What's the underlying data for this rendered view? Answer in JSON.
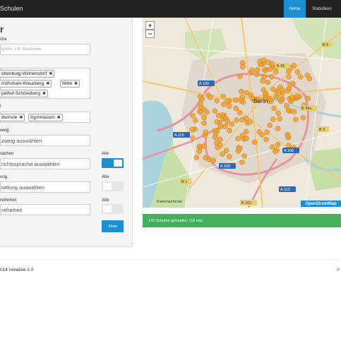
{
  "navbar": {
    "brand": "Schulen",
    "home_label": "Home",
    "stats_label": "Statistiken"
  },
  "filter": {
    "title": "r",
    "search": {
      "label": "che",
      "placeholder": "Suche, z.B. Schulname"
    },
    "districts": {
      "tags": [
        "ottenburg-Wilmersdorf",
        "rrichshain-Kreuzberg",
        "Mitte",
        "pelhof-Schöneberg"
      ]
    },
    "type": {
      "label": "l",
      "tags": [
        "dschule",
        "Gymnasium"
      ]
    },
    "branch": {
      "label": "weig",
      "placeholder": "zweig auswählen"
    },
    "language": {
      "label": "sachen",
      "placeholder": "richtssprache auswählen",
      "toggle_label": "Alle",
      "toggle_on": true
    },
    "equipment": {
      "label": "ung",
      "placeholder": "tattung auswählen",
      "toggle_label": "Alle",
      "toggle_on": false
    },
    "barrier": {
      "label": "refreiheit",
      "placeholder": "refreiheit",
      "toggle_label": "Alle",
      "toggle_on": false
    },
    "show_button": "Show"
  },
  "map": {
    "zoom_in": "+",
    "zoom_out": "−",
    "attribution": "OpenStreetMap",
    "city_label": "Berlin",
    "place_label": "Kleinmachnow",
    "road_labels": [
      "A 100",
      "A 100",
      "A 115",
      "A 100",
      "A 113",
      "B 96",
      "B 96a",
      "B 101",
      "B 1",
      "B 2",
      "B 5"
    ],
    "colors": {
      "marker": "#f0a030",
      "marker_stroke": "#c07010",
      "motorway": "#e892a2",
      "primary": "#f7c66e",
      "water": "#aad3df",
      "green": "#c8dfa8"
    }
  },
  "result": {
    "text": "176 Schulen gefunden. (18 ms)"
  },
  "footer": {
    "text": "014 Initiative 2.0",
    "link": "Ir"
  }
}
